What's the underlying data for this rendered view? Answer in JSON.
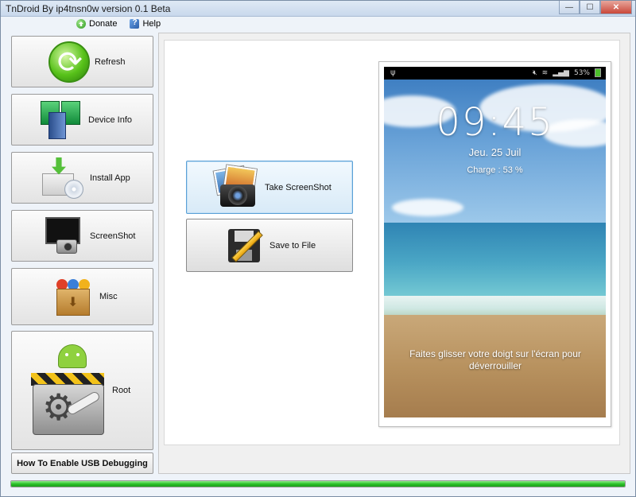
{
  "window": {
    "title": "TnDroid By ip4tnsn0w version 0.1 Beta",
    "minimize": "—",
    "maximize": "☐",
    "close": "✕"
  },
  "menu": {
    "items": [
      {
        "label": "Donate",
        "icon": "donate-icon"
      },
      {
        "label": "Help",
        "icon": "help-icon"
      }
    ]
  },
  "sidebar": {
    "buttons": [
      {
        "label": "Refresh",
        "icon": "refresh-icon"
      },
      {
        "label": "Device Info",
        "icon": "device-info-icon"
      },
      {
        "label": "Install App",
        "icon": "install-app-icon"
      },
      {
        "label": "ScreenShot",
        "icon": "screenshot-icon"
      },
      {
        "label": "Misc",
        "icon": "misc-icon"
      },
      {
        "label": "Root",
        "icon": "root-icon"
      }
    ],
    "usb_label": "How To Enable USB Debugging"
  },
  "actions": {
    "take_screenshot": {
      "label": "Take ScreenShot",
      "icon": "camera-icon"
    },
    "save_to_file": {
      "label": "Save to File",
      "icon": "floppy-icon"
    }
  },
  "phone": {
    "battery_percent": "53%",
    "time": "09:45",
    "date": "Jeu. 25 Juil",
    "charge": "Charge : 53 %",
    "unlock_text": "Faites glisser votre doigt sur l'écran pour déverrouiller"
  },
  "progress": {
    "value": 1.0
  },
  "colors": {
    "progress_green": "#2dc12a",
    "active_button_border": "#5aa0d6"
  }
}
